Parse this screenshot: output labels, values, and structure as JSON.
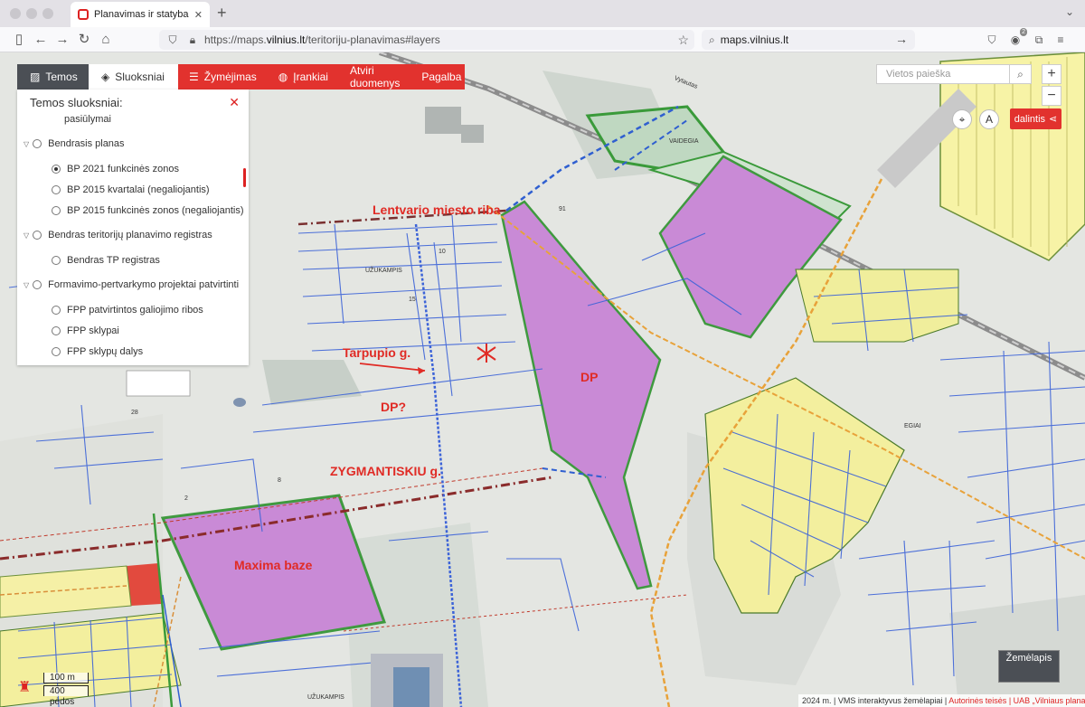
{
  "browser": {
    "tab_title": "Planavimas ir statyba / Vilniaus",
    "url_prefix": "https://maps.",
    "url_domain": "vilnius.lt",
    "url_path": "/teritoriju-planavimas#layers",
    "search_text": "maps.vilnius.lt",
    "extension_badge": "2"
  },
  "app": {
    "tabs": [
      {
        "label": "Temos",
        "icon": "chart-icon"
      },
      {
        "label": "Sluoksniai",
        "icon": "layers-icon"
      }
    ],
    "menu": [
      {
        "label": "Žymėjimas",
        "icon": "list-icon"
      },
      {
        "label": "Įrankiai",
        "icon": "globe-icon"
      },
      {
        "label": "Atviri duomenys"
      },
      {
        "label": "Pagalba"
      }
    ],
    "search_placeholder": "Vietos paieška",
    "share_label": "dalintis",
    "zoom_in": "+",
    "zoom_out": "−",
    "basemap_label": "Žemėlapis"
  },
  "panel": {
    "title": "Temos sluoksniai:",
    "items": [
      {
        "label": "pasiūlymai",
        "type": "text"
      },
      {
        "label": "Bendrasis planas",
        "type": "group"
      },
      {
        "label": "BP 2021 funkcinės zonos",
        "type": "radio",
        "selected": true
      },
      {
        "label": "BP 2015 kvartalai (negaliojantis)",
        "type": "radio",
        "selected": false
      },
      {
        "label": "BP 2015 funkcinės zonos (negaliojantis)",
        "type": "radio",
        "selected": false
      },
      {
        "label": "Bendras teritorijų planavimo registras",
        "type": "group"
      },
      {
        "label": "Bendras TP registras",
        "type": "radio",
        "selected": false
      },
      {
        "label": "Formavimo-pertvarkymo projektai patvirtinti",
        "type": "group"
      },
      {
        "label": "FPP patvirtintos galiojimo ribos",
        "type": "radio",
        "selected": false
      },
      {
        "label": "FPP sklypai",
        "type": "radio",
        "selected": false
      },
      {
        "label": "FPP sklypų dalys",
        "type": "radio",
        "selected": false
      }
    ]
  },
  "map": {
    "annotations": {
      "boundary": "Lentvario miesto riba",
      "street": "Tarpupio g.",
      "dp_question": "DP?",
      "dp": "DP",
      "zygmantiskiu": "ZYGMANTISKIU g.",
      "maxima": "Maxima baze"
    },
    "labels": {
      "vaidegia": "VAIDEGIA",
      "uzukampis_top": "UŽUKAMPIS",
      "uzukampis_bottom": "UŽUKAMPIS",
      "egiai": "EGIAI",
      "vilniaus": "Vytautas",
      "num_91": "91",
      "num_10": "10",
      "num_15": "15",
      "num_28": "28",
      "num_8": "8",
      "num_2": "2"
    },
    "scale_metric": "100 m",
    "scale_imperial": "400 pėdos",
    "attribution_year": "2024 m. | VMS interaktyvus žemėlapiai |",
    "attribution_rights": "Autorinės teisės",
    "attribution_owner": "| UAB „Vilniaus planas\""
  }
}
